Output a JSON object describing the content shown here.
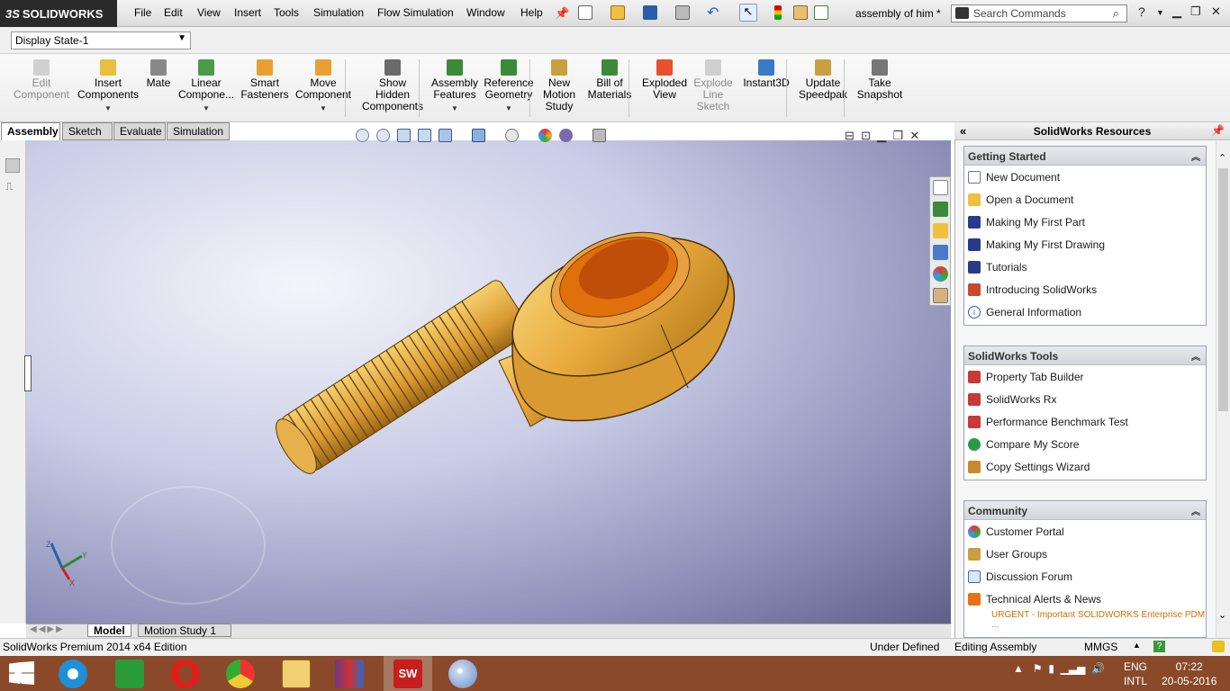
{
  "app": {
    "logo_text": "SOLIDWORKS",
    "logo_prefix": "3S"
  },
  "menu": [
    "File",
    "Edit",
    "View",
    "Insert",
    "Tools",
    "Simulation",
    "Flow Simulation",
    "Window",
    "Help"
  ],
  "document_title": "assembly of him *",
  "search": {
    "placeholder": "Search Commands"
  },
  "config": {
    "selected": "Display State-1"
  },
  "ribbon": [
    {
      "label": "Edit\nComponent",
      "disabled": true,
      "icon": "edit-component-icon"
    },
    {
      "label": "Insert\nComponents",
      "disabled": false,
      "icon": "insert-components-icon",
      "dropdown": true
    },
    {
      "label": "Mate",
      "disabled": false,
      "icon": "mate-icon"
    },
    {
      "label": "Linear\nCompone...",
      "disabled": false,
      "icon": "linear-pattern-icon",
      "dropdown": true
    },
    {
      "label": "Smart\nFasteners",
      "disabled": false,
      "icon": "smart-fasteners-icon"
    },
    {
      "label": "Move\nComponent",
      "disabled": false,
      "icon": "move-component-icon",
      "dropdown": true
    },
    {
      "label": "Show\nHidden\nComponents",
      "disabled": false,
      "icon": "show-hidden-icon"
    },
    {
      "label": "Assembly\nFeatures",
      "disabled": false,
      "icon": "assembly-features-icon",
      "dropdown": true
    },
    {
      "label": "Reference\nGeometry",
      "disabled": false,
      "icon": "reference-geometry-icon",
      "dropdown": true
    },
    {
      "label": "New\nMotion\nStudy",
      "disabled": false,
      "icon": "motion-study-icon"
    },
    {
      "label": "Bill of\nMaterials",
      "disabled": false,
      "icon": "bom-icon"
    },
    {
      "label": "Exploded\nView",
      "disabled": false,
      "icon": "exploded-view-icon"
    },
    {
      "label": "Explode\nLine\nSketch",
      "disabled": true,
      "icon": "explode-line-icon"
    },
    {
      "label": "Instant3D",
      "disabled": false,
      "icon": "instant3d-icon"
    },
    {
      "label": "Update\nSpeedpak",
      "disabled": false,
      "icon": "speedpak-icon"
    },
    {
      "label": "Take\nSnapshot",
      "disabled": false,
      "icon": "snapshot-icon"
    }
  ],
  "command_tabs": [
    "Assembly",
    "Sketch",
    "Evaluate",
    "Simulation"
  ],
  "bottom_tabs": [
    "Model",
    "Motion Study 1"
  ],
  "resources": {
    "title": "SolidWorks Resources",
    "groups": [
      {
        "title": "Getting Started",
        "items": [
          "New Document",
          "Open a Document",
          "Making My First Part",
          "Making My First Drawing",
          "Tutorials",
          "Introducing SolidWorks",
          "General Information"
        ]
      },
      {
        "title": "SolidWorks Tools",
        "items": [
          "Property Tab Builder",
          "SolidWorks Rx",
          "Performance Benchmark Test",
          "Compare My Score",
          "Copy Settings Wizard"
        ]
      },
      {
        "title": "Community",
        "items": [
          "Customer Portal",
          "User Groups",
          "Discussion Forum",
          "Technical Alerts & News"
        ],
        "urgent": "URGENT - Important SOLIDWORKS Enterprise PDM ..."
      }
    ]
  },
  "status": {
    "edition": "SolidWorks Premium 2014 x64 Edition",
    "state": "Under Defined",
    "mode": "Editing Assembly",
    "units": "MMGS"
  },
  "taskbar": {
    "lang1": "ENG",
    "lang2": "INTL",
    "time": "07:22",
    "date": "20-05-2016"
  },
  "colors": {
    "part_gold": "#e8a93c",
    "bore_orange": "#e0700c",
    "taskbar": "#8a4a2a"
  }
}
